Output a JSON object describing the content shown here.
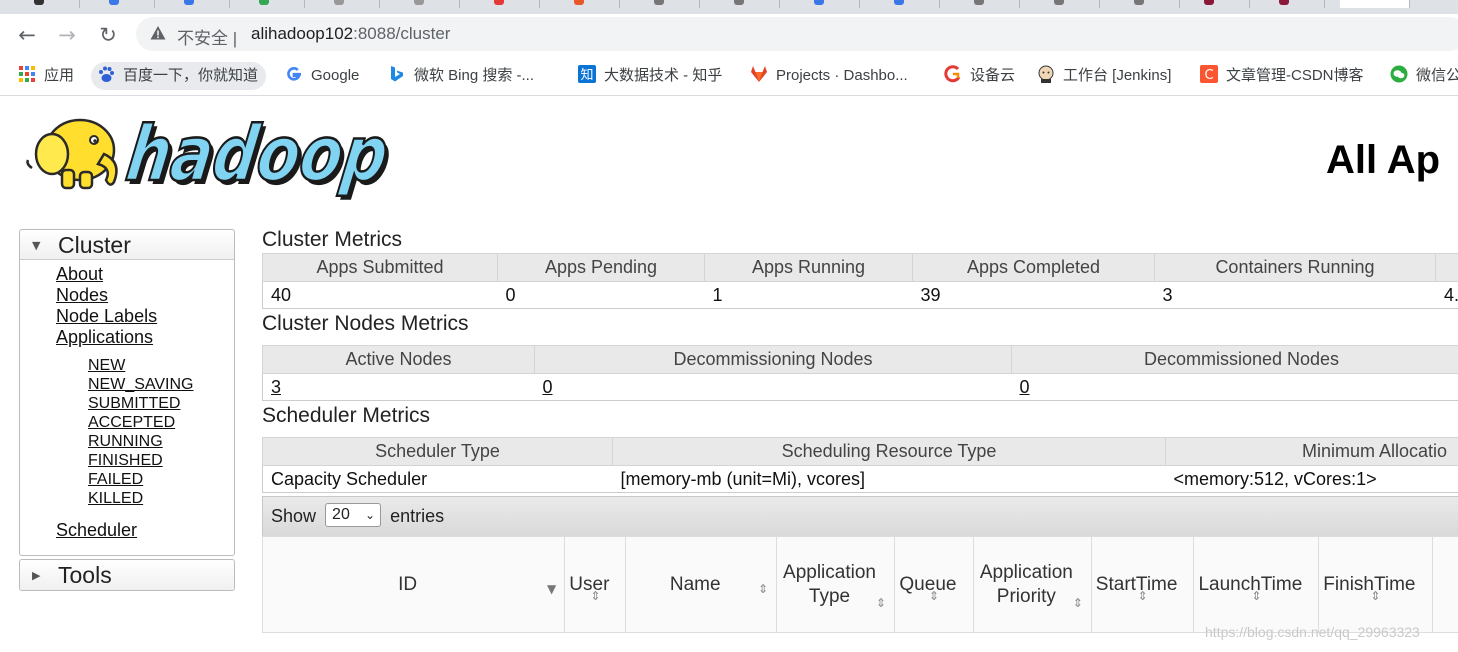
{
  "browser": {
    "not_secure_label": "不安全",
    "url_host": "alihadoop102",
    "url_rest": ":8088/cluster",
    "bookmarks": [
      {
        "label": "应用",
        "icon": "apps-grid-icon"
      },
      {
        "label": "百度一下，你就知道",
        "icon": "baidu-icon"
      },
      {
        "label": "Google",
        "icon": "google-icon"
      },
      {
        "label": "微软 Bing 搜索 -...",
        "icon": "bing-icon"
      },
      {
        "label": "大数据技术 - 知乎",
        "icon": "zhihu-icon"
      },
      {
        "label": "Projects · Dashbo...",
        "icon": "gitlab-icon"
      },
      {
        "label": "设备云",
        "icon": "device-cloud-icon"
      },
      {
        "label": "工作台 [Jenkins]",
        "icon": "jenkins-icon"
      },
      {
        "label": "文章管理-CSDN博客",
        "icon": "csdn-icon"
      },
      {
        "label": "微信公",
        "icon": "wechat-icon"
      }
    ]
  },
  "page": {
    "title": "All Ap"
  },
  "nav": {
    "cluster_label": "Cluster",
    "links": [
      "About",
      "Nodes",
      "Node Labels",
      "Applications"
    ],
    "app_states": [
      "NEW",
      "NEW_SAVING",
      "SUBMITTED",
      "ACCEPTED",
      "RUNNING",
      "FINISHED",
      "FAILED",
      "KILLED"
    ],
    "scheduler_label": "Scheduler",
    "tools_label": "Tools"
  },
  "cluster_metrics": {
    "title": "Cluster Metrics",
    "headers": [
      "Apps Submitted",
      "Apps Pending",
      "Apps Running",
      "Apps Completed",
      "Containers Running"
    ],
    "values": [
      "40",
      "0",
      "1",
      "39",
      "3",
      "4."
    ]
  },
  "nodes_metrics": {
    "title": "Cluster Nodes Metrics",
    "headers": [
      "Active Nodes",
      "Decommissioning Nodes",
      "Decommissioned Nodes"
    ],
    "values": [
      "3",
      "0",
      "0"
    ]
  },
  "scheduler_metrics": {
    "title": "Scheduler Metrics",
    "headers": [
      "Scheduler Type",
      "Scheduling Resource Type",
      "Minimum Allocatio"
    ],
    "values": [
      "Capacity Scheduler",
      "[memory-mb (unit=Mi), vcores]",
      "<memory:512, vCores:1>"
    ]
  },
  "apps_table": {
    "show_label": "Show",
    "page_size": "20",
    "entries_label": "entries",
    "columns": [
      {
        "l1": "ID",
        "l2": ""
      },
      {
        "l1": "User",
        "l2": ""
      },
      {
        "l1": "Name",
        "l2": ""
      },
      {
        "l1": "Application",
        "l2": "Type"
      },
      {
        "l1": "Queue",
        "l2": ""
      },
      {
        "l1": "Application",
        "l2": "Priority"
      },
      {
        "l1": "StartTime",
        "l2": ""
      },
      {
        "l1": "LaunchTime",
        "l2": ""
      },
      {
        "l1": "FinishTime",
        "l2": ""
      }
    ]
  },
  "watermark": "https://blog.csdn.net/qq_29963323"
}
